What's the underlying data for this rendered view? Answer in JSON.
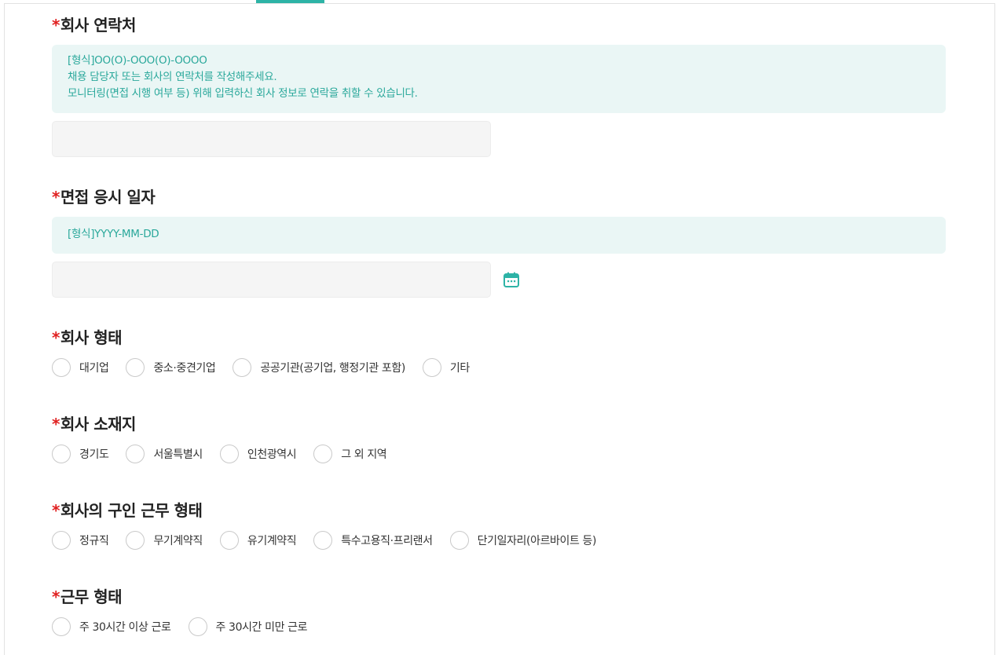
{
  "contact": {
    "title": "회사 연락처",
    "required_mark": "*",
    "info_lines": [
      "[형식]OO(O)-OOO(O)-OOOO",
      "채용 담당자 또는 회사의 연락처를 작성해주세요.",
      "모니터링(면접 시행 여부 등) 위해 입력하신 회사 정보로 연락을 취할 수 있습니다."
    ],
    "input_value": "",
    "input_placeholder": ""
  },
  "interview_date": {
    "title": "면접 응시 일자",
    "required_mark": "*",
    "info_lines": [
      "[형식]YYYY-MM-DD"
    ],
    "input_value": "",
    "input_placeholder": "",
    "icon": "calendar-icon"
  },
  "company_type": {
    "title": "회사 형태",
    "required_mark": "*",
    "options": [
      "대기업",
      "중소·중견기업",
      "공공기관(공기업, 행정기관 포함)",
      "기타"
    ]
  },
  "company_location": {
    "title": "회사 소재지",
    "required_mark": "*",
    "options": [
      "경기도",
      "서울특별시",
      "인천광역시",
      "그 외 지역"
    ]
  },
  "employment_type": {
    "title": "회사의 구인 근무 형태",
    "required_mark": "*",
    "options": [
      "정규직",
      "무기계약직",
      "유기계약직",
      "특수고용직·프리랜서",
      "단기일자리(아르바이트 등)"
    ]
  },
  "work_hours": {
    "title": "근무 형태",
    "required_mark": "*",
    "options": [
      "주 30시간 이상 근로",
      "주 30시간 미만 근로"
    ]
  },
  "colors": {
    "accent": "#2db3a6",
    "info_bg": "#eaf6f5",
    "required": "#e02020"
  }
}
